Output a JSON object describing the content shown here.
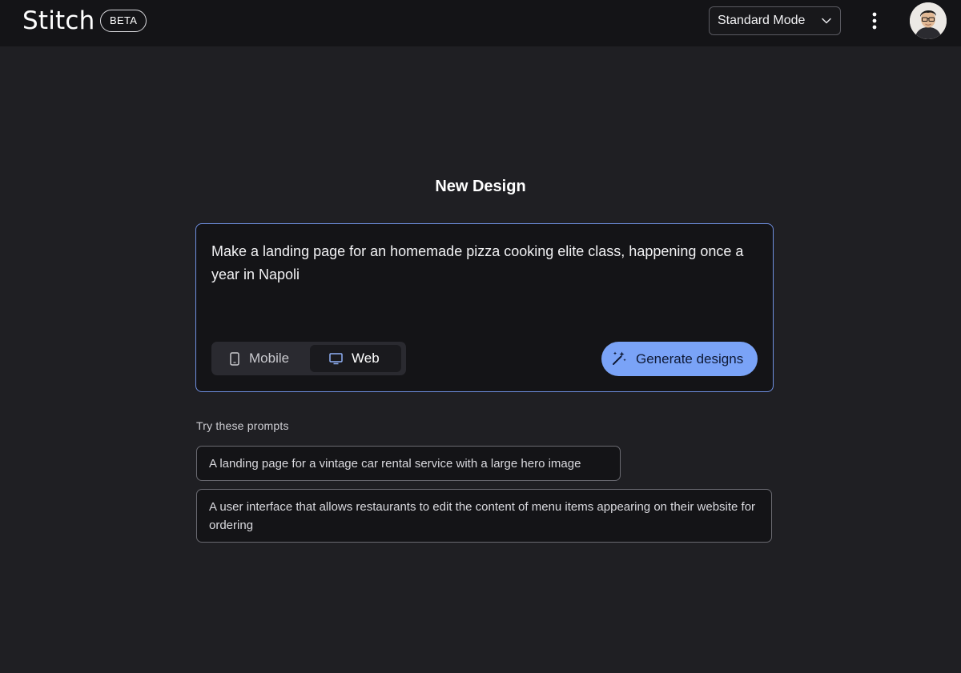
{
  "header": {
    "app_name": "Stitch",
    "badge": "BETA",
    "mode_select": {
      "value": "Standard Mode"
    },
    "icons": [
      "chevron-down-icon",
      "more-vert-icon",
      "avatar"
    ]
  },
  "main": {
    "title": "New Design",
    "prompt_input": {
      "value": "Make a landing page for an homemade pizza cooking elite class, happening once a year in Napoli"
    },
    "device_toggle": {
      "options": [
        {
          "label": "Mobile",
          "icon": "phone-icon",
          "selected": false
        },
        {
          "label": "Web",
          "icon": "monitor-icon",
          "selected": true
        }
      ]
    },
    "generate_button": {
      "label": "Generate designs",
      "icon": "magic-wand-icon"
    },
    "suggestions": {
      "label": "Try these prompts",
      "items": [
        "A landing page for a vintage car rental service with a large hero image",
        "A user interface that allows restaurants to edit the content of menu items appearing on their website for ordering"
      ]
    }
  },
  "colors": {
    "background": "#1f1f23",
    "topbar": "#141417",
    "accent": "#7aa3f7",
    "composer_border": "#6f8fe0"
  }
}
